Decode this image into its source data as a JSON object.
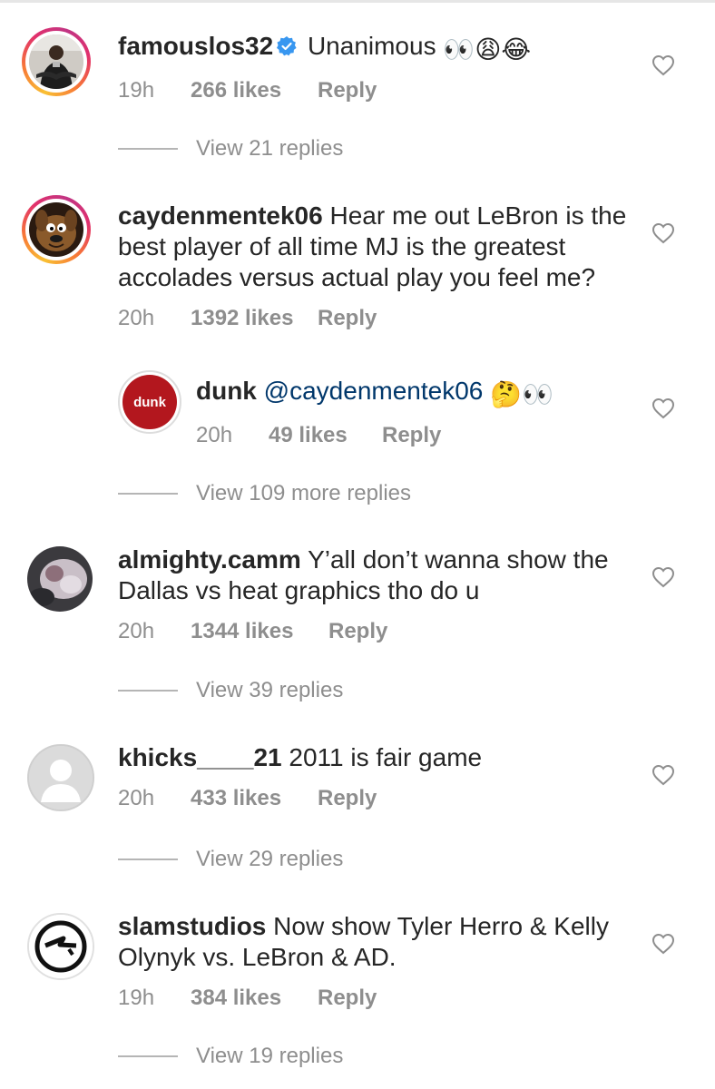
{
  "comments": [
    {
      "username": "famouslos32",
      "verified": true,
      "text": "Unanimous",
      "emoji": "👀😩😂",
      "time": "19h",
      "likes": "266 likes",
      "reply": "Reply",
      "view_replies": "View 21 replies"
    },
    {
      "username": "caydenmentek06",
      "text": "Hear me out LeBron is the best player of all time MJ is the greatest accolades versus actual play you feel me?",
      "time": "20h",
      "likes": "1392 likes",
      "reply": "Reply"
    },
    {
      "username": "dunk",
      "mention": "@caydenmentek06",
      "emoji": "🤔👀",
      "avatar_text": "dunk",
      "time": "20h",
      "likes": "49 likes",
      "reply": "Reply",
      "view_replies": "View 109 more replies"
    },
    {
      "username": "almighty.camm",
      "text": "Y’all don’t wanna show the Dallas vs heat graphics tho do u",
      "time": "20h",
      "likes": "1344 likes",
      "reply": "Reply",
      "view_replies": "View 39 replies"
    },
    {
      "username": "khicks____21",
      "text": "2011 is fair game",
      "time": "20h",
      "likes": "433 likes",
      "reply": "Reply",
      "view_replies": "View 29 replies"
    },
    {
      "username": "slamstudios",
      "text": "Now show Tyler Herro & Kelly Olynyk vs. LeBron & AD.",
      "time": "19h",
      "likes": "384 likes",
      "reply": "Reply",
      "view_replies": "View 19 replies"
    }
  ],
  "colors": {
    "text": "#262626",
    "meta": "#8e8e8e",
    "mention": "#00376b",
    "verified": "#3897f0",
    "dunk_red": "#b3171e"
  },
  "icons": {
    "like": "heart-outline-icon",
    "verified": "verified-badge-icon"
  }
}
